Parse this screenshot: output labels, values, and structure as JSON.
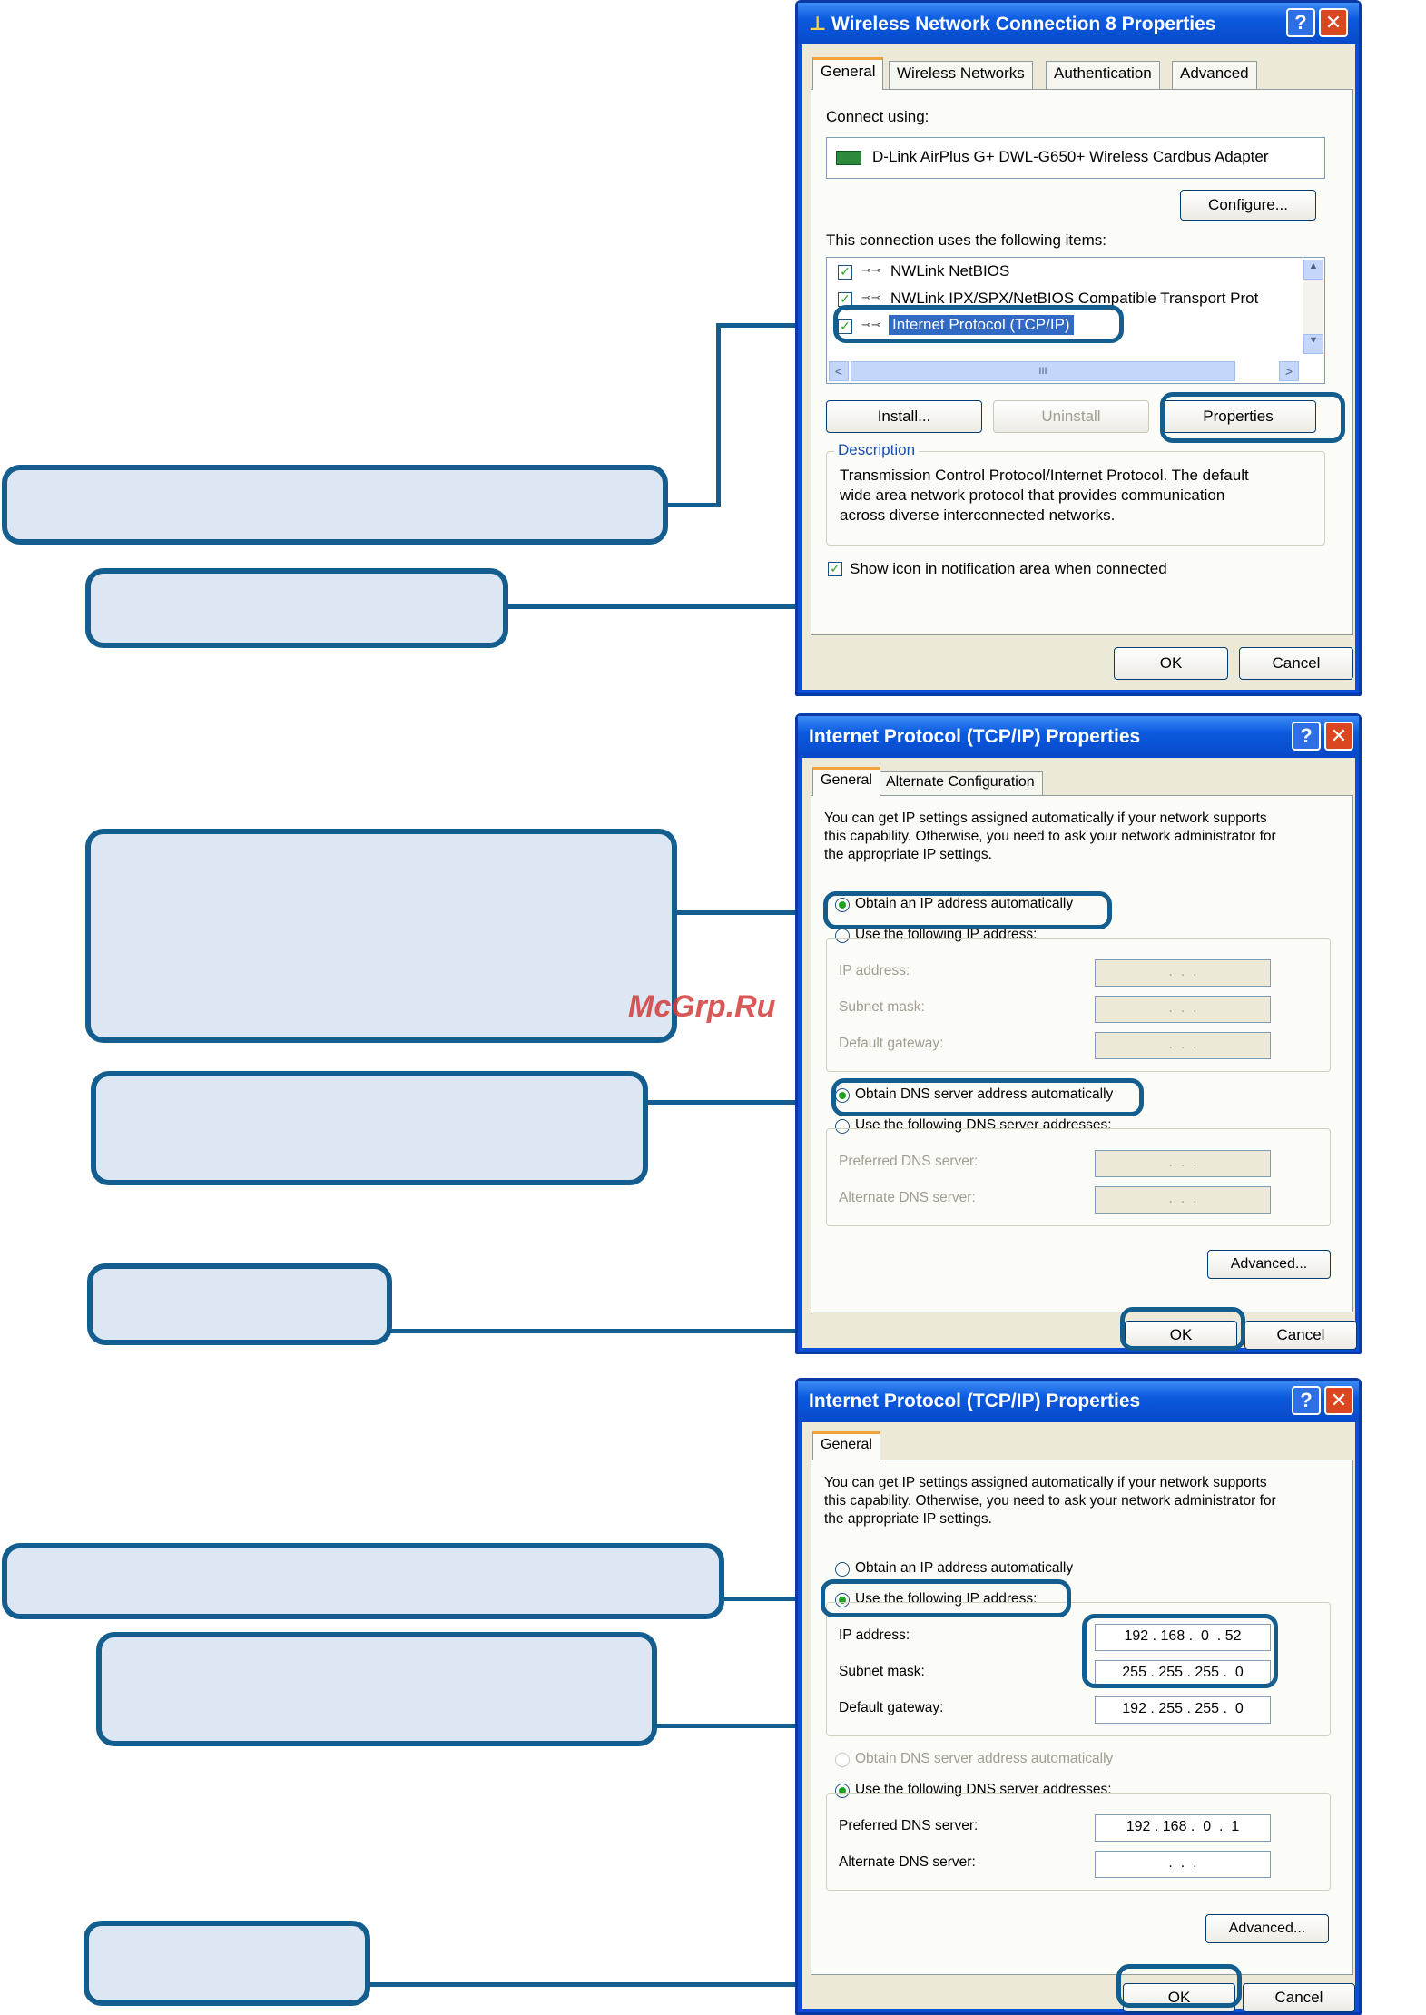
{
  "dialog1": {
    "title": "Wireless Network Connection 8 Properties",
    "help_glyph": "?",
    "close_glyph": "✕",
    "tabs": [
      "General",
      "Wireless Networks",
      "Authentication",
      "Advanced"
    ],
    "connect_using_label": "Connect using:",
    "adapter_name": "D-Link AirPlus G+ DWL-G650+ Wireless Cardbus Adapter",
    "configure_label": "Configure...",
    "items_label": "This connection uses the following items:",
    "items": [
      "NWLink NetBIOS",
      "NWLink IPX/SPX/NetBIOS Compatible Transport Prot",
      "Internet Protocol (TCP/IP)"
    ],
    "scroll_left": "<",
    "scroll_right": ">",
    "scroll_grip": "III",
    "install_label": "Install...",
    "uninstall_label": "Uninstall",
    "properties_label": "Properties",
    "description_title": "Description",
    "description_lines": [
      "Transmission Control Protocol/Internet Protocol. The default",
      "wide area network protocol that provides communication",
      "across diverse interconnected networks."
    ],
    "show_icon_label": "Show icon in notification area when connected",
    "ok_label": "OK",
    "cancel_label": "Cancel"
  },
  "dialog2": {
    "title": "Internet Protocol (TCP/IP) Properties",
    "help_glyph": "?",
    "close_glyph": "✕",
    "tabs": [
      "General",
      "Alternate Configuration"
    ],
    "intro_lines": [
      "You can get IP settings assigned automatically if your network supports",
      "this capability. Otherwise, you need to ask your network administrator for",
      "the appropriate IP settings."
    ],
    "obtain_ip_label": "Obtain an IP address automatically",
    "use_ip_label": "Use the following IP address:",
    "ip_label": "IP address:",
    "subnet_label": "Subnet mask:",
    "gateway_label": "Default gateway:",
    "empty_ip": " .  .  . ",
    "obtain_dns_label": "Obtain DNS server address automatically",
    "use_dns_label": "Use the following DNS server addresses:",
    "preferred_dns_label": "Preferred DNS server:",
    "alternate_dns_label": "Alternate DNS server:",
    "advanced_label": "Advanced...",
    "ok_label": "OK",
    "cancel_label": "Cancel"
  },
  "dialog3": {
    "title": "Internet Protocol (TCP/IP) Properties",
    "help_glyph": "?",
    "close_glyph": "✕",
    "tabs": [
      "General"
    ],
    "intro_lines": [
      "You can get IP settings assigned automatically if your network supports",
      "this capability. Otherwise, you need to ask your network administrator for",
      "the appropriate IP settings."
    ],
    "obtain_ip_label": "Obtain an IP address automatically",
    "use_ip_label": "Use the following IP address:",
    "ip_label": "IP address:",
    "ip_value": "192 . 168 .  0  . 52",
    "subnet_label": "Subnet mask:",
    "subnet_value": "255 . 255 . 255 .  0",
    "gateway_label": "Default gateway:",
    "gateway_value": "192 . 255 . 255 .  0",
    "obtain_dns_label": "Obtain DNS server address automatically",
    "use_dns_label": "Use the following DNS server addresses:",
    "preferred_dns_label": "Preferred DNS server:",
    "preferred_dns_value": "192 . 168 .  0  .  1",
    "alternate_dns_label": "Alternate DNS server:",
    "alternate_dns_value": " .  .  . ",
    "advanced_label": "Advanced...",
    "ok_label": "OK",
    "cancel_label": "Cancel"
  },
  "watermark": "McGrp.Ru",
  "colors": {
    "callout_border": "#135e8f",
    "callout_fill": "#dde7f3",
    "xp_title_blue": "#0b5ae0",
    "dialog_face": "#ece9d8"
  }
}
